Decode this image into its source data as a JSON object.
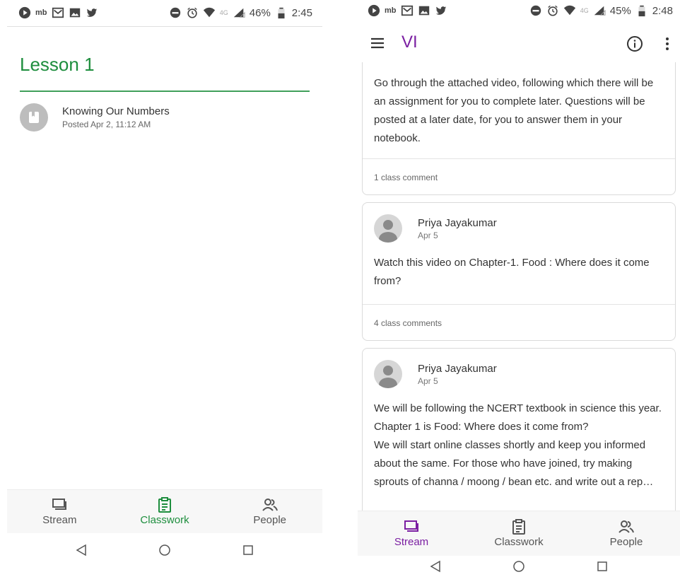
{
  "left": {
    "status": {
      "battery": "46%",
      "time": "2:45",
      "network": "4G",
      "app_badge": "mb"
    },
    "lesson_title": "Lesson 1",
    "material": {
      "title": "Knowing Our Numbers",
      "meta": "Posted Apr 2, 11:12 AM"
    },
    "nav": {
      "stream": "Stream",
      "classwork": "Classwork",
      "people": "People",
      "active": "classwork"
    }
  },
  "right": {
    "status": {
      "battery": "45%",
      "time": "2:48",
      "network": "4G",
      "app_badge": "mb"
    },
    "class_name": "VI",
    "posts": [
      {
        "body": "Go through the attached video, following which there will be an assignment for you to complete later. Questions will be posted at a later date, for you to answer them in your notebook.",
        "comments": "1 class comment"
      },
      {
        "author": "Priya Jayakumar",
        "date": "Apr 5",
        "body": "Watch this video on Chapter-1. Food : Where does it come from?",
        "comments": "4 class comments"
      },
      {
        "author": "Priya Jayakumar",
        "date": "Apr 5",
        "body": "We will be following the NCERT textbook in science this year. Chapter 1 is Food: Where does it come from?\nWe will start online classes shortly and keep you informed about the same. For those who have joined, try making sprouts of channa / moong / bean etc. and write out a rep…"
      }
    ],
    "nav": {
      "stream": "Stream",
      "classwork": "Classwork",
      "people": "People",
      "active": "stream"
    }
  },
  "colors": {
    "classwork_green": "#1e8e3e",
    "class_purple": "#7b1fa2"
  },
  "icons": [
    "play-circle-icon",
    "gmail-icon",
    "image-icon",
    "twitter-icon",
    "do-not-disturb-icon",
    "alarm-icon",
    "wifi-icon",
    "signal-icon",
    "battery-icon",
    "menu-icon",
    "info-icon",
    "more-vert-icon",
    "book-icon",
    "stream-icon",
    "classwork-icon",
    "people-icon",
    "back-icon",
    "home-icon",
    "recents-icon"
  ]
}
